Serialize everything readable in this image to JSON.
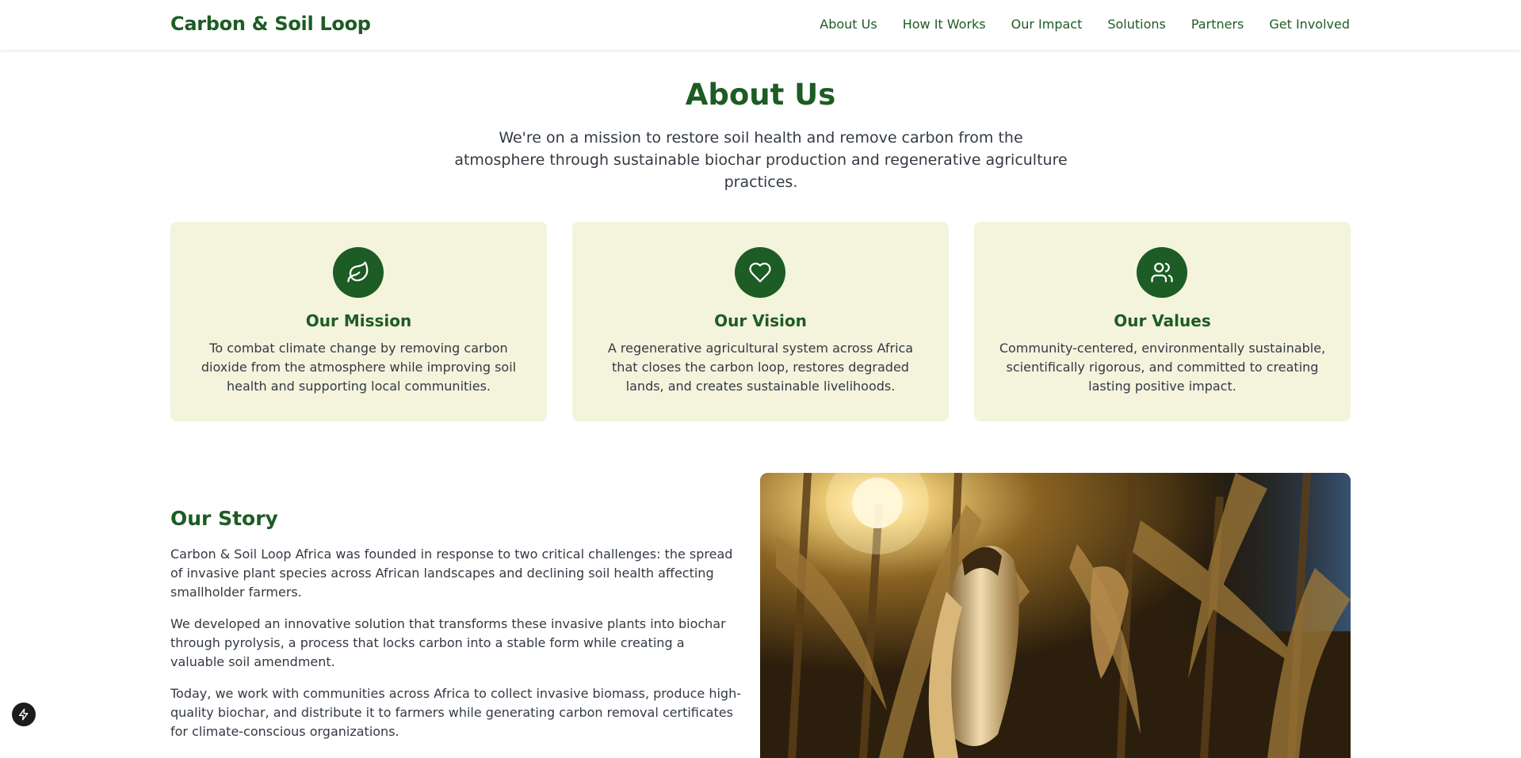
{
  "brand": "Carbon & Soil Loop",
  "nav": [
    {
      "label": "About Us"
    },
    {
      "label": "How It Works"
    },
    {
      "label": "Our Impact"
    },
    {
      "label": "Solutions"
    },
    {
      "label": "Partners"
    },
    {
      "label": "Get Involved"
    }
  ],
  "hero": {
    "title": "About Us",
    "subtitle": "We're on a mission to restore soil health and remove carbon from the atmosphere through sustainable biochar production and regenerative agriculture practices."
  },
  "cards": [
    {
      "icon": "leaf-icon",
      "title": "Our Mission",
      "text": "To combat climate change by removing carbon dioxide from the atmosphere while improving soil health and supporting local communities."
    },
    {
      "icon": "heart-icon",
      "title": "Our Vision",
      "text": "A regenerative agricultural system across Africa that closes the carbon loop, restores degraded lands, and creates sustainable livelihoods."
    },
    {
      "icon": "users-icon",
      "title": "Our Values",
      "text": "Community-centered, environmentally sustainable, scientifically rigorous, and committed to creating lasting positive impact."
    }
  ],
  "story": {
    "title": "Our Story",
    "paragraphs": [
      "Carbon & Soil Loop Africa was founded in response to two critical challenges: the spread of invasive plant species across African landscapes and declining soil health affecting smallholder farmers.",
      "We developed an innovative solution that transforms these invasive plants into biochar through pyrolysis, a process that locks carbon into a stable form while creating a valuable soil amendment.",
      "Today, we work with communities across Africa to collect invasive biomass, produce high-quality biochar, and distribute it to farmers while generating carbon removal certificates for climate-conscious organizations."
    ],
    "image": "corn-field-photo"
  },
  "colors": {
    "brand_green": "#1d5c24",
    "card_bg": "#f4f3dc",
    "text": "#333a44"
  }
}
